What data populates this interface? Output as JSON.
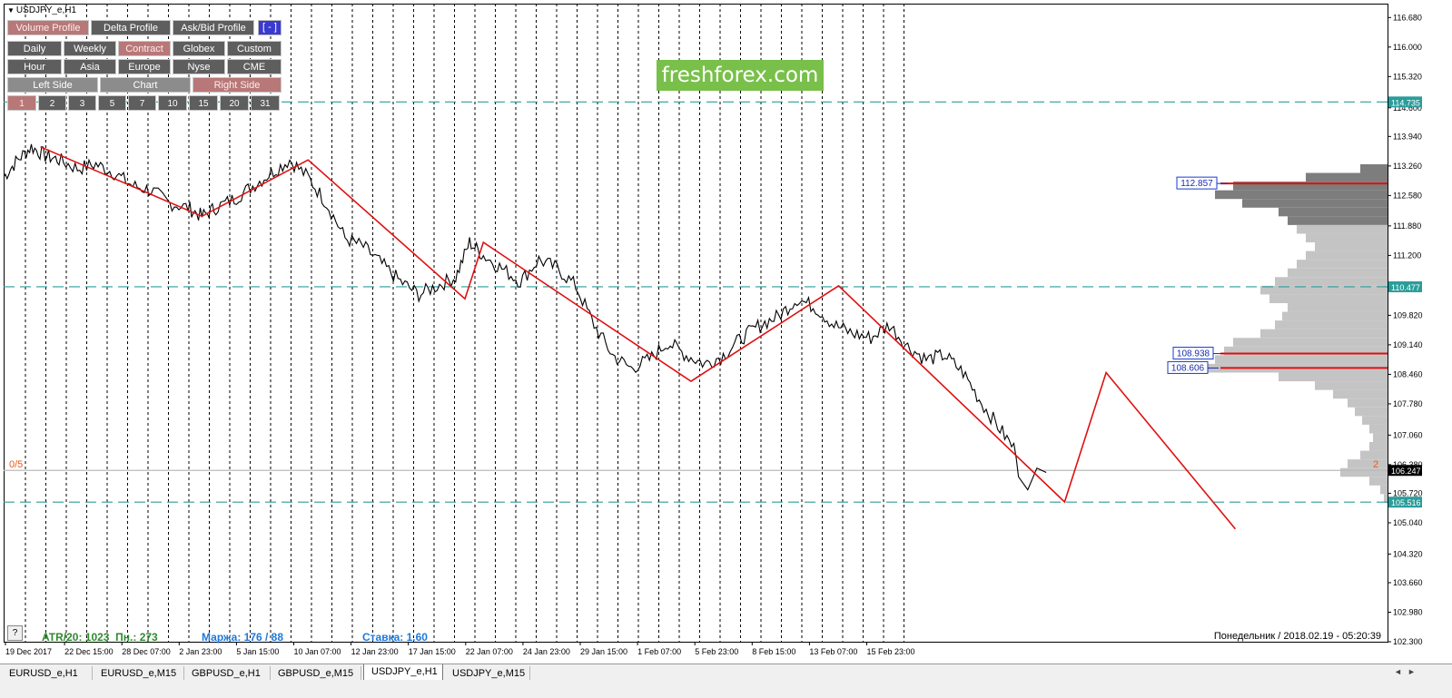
{
  "window": {
    "title": "USDJPY_e,H1"
  },
  "panel": {
    "row1": [
      {
        "label": "Volume Profile",
        "active": true
      },
      {
        "label": "Delta Profile",
        "active": false
      },
      {
        "label": "Ask/Bid Profile",
        "active": false
      }
    ],
    "collapse_label": "[ - ]",
    "row2": [
      {
        "label": "Daily",
        "active": false
      },
      {
        "label": "Weekly",
        "active": false
      },
      {
        "label": "Contract",
        "active": true
      },
      {
        "label": "Globex",
        "active": false
      },
      {
        "label": "Custom",
        "active": false
      }
    ],
    "row3": [
      {
        "label": "Hour",
        "active": false
      },
      {
        "label": "Asia",
        "active": false
      },
      {
        "label": "Europe",
        "active": false
      },
      {
        "label": "Nyse",
        "active": false
      },
      {
        "label": "CME",
        "active": false
      }
    ],
    "row4": [
      {
        "label": "Left Side",
        "active": false
      },
      {
        "label": "Chart",
        "active": false
      },
      {
        "label": "Right Side",
        "active": true
      }
    ],
    "row5": [
      {
        "label": "1",
        "active": true
      },
      {
        "label": "2",
        "active": false
      },
      {
        "label": "3",
        "active": false
      },
      {
        "label": "5",
        "active": false
      },
      {
        "label": "7",
        "active": false
      },
      {
        "label": "10",
        "active": false
      },
      {
        "label": "15",
        "active": false
      },
      {
        "label": "20",
        "active": false
      },
      {
        "label": "31",
        "active": false
      }
    ]
  },
  "logo": "freshforex.com",
  "status": {
    "atr": "ATR/20: 1023",
    "pn": "Пн.: 273",
    "margin": "Маржа: 176 / 88",
    "rate": "Ставка: 1.60",
    "datetime": "Понедельник  /  2018.02.19  -  05:20:39",
    "help": "?",
    "zero_five": "0/5",
    "right_num": "2"
  },
  "chart_data": {
    "type": "line",
    "symbol": "USDJPY_e,H1",
    "ylim": [
      102.3,
      117.0
    ],
    "price_ticks": [
      "116.680",
      "116.000",
      "115.320",
      "114.600",
      "113.940",
      "113.260",
      "112.580",
      "111.880",
      "111.200",
      "110.520",
      "109.820",
      "109.140",
      "108.460",
      "107.780",
      "107.060",
      "106.380",
      "105.720",
      "105.040",
      "104.320",
      "103.660",
      "102.980",
      "102.300"
    ],
    "time_ticks": [
      "19 Dec 2017",
      "22 Dec 15:00",
      "28 Dec 07:00",
      "2 Jan 23:00",
      "5 Jan 15:00",
      "10 Jan 07:00",
      "12 Jan 23:00",
      "17 Jan 15:00",
      "22 Jan 07:00",
      "24 Jan 23:00",
      "29 Jan 15:00",
      "1 Feb 07:00",
      "5 Feb 23:00",
      "8 Feb 15:00",
      "13 Feb 07:00",
      "15 Feb 23:00"
    ],
    "price_series": {
      "name": "USDJPY H1",
      "x": [
        0,
        3,
        6,
        9,
        12,
        16,
        20,
        24,
        28,
        32,
        36,
        40,
        43,
        46,
        50,
        54,
        58,
        62,
        66,
        70,
        74,
        78,
        82,
        86,
        90,
        94,
        98,
        101,
        104,
        108,
        112,
        116,
        120,
        124,
        128,
        132,
        136,
        140,
        144,
        148,
        152,
        156,
        160,
        164,
        168,
        172,
        176,
        180,
        184,
        188,
        192,
        196,
        200,
        204,
        208,
        212,
        216,
        220
      ],
      "y": [
        113.0,
        113.4,
        113.7,
        113.5,
        113.4,
        113.2,
        113.3,
        113.1,
        112.8,
        112.7,
        112.4,
        112.3,
        112.1,
        112.3,
        112.5,
        112.8,
        113.1,
        113.4,
        113.0,
        112.4,
        111.6,
        111.4,
        111.0,
        110.6,
        110.3,
        110.5,
        110.7,
        111.5,
        111.2,
        110.9,
        110.6,
        111.1,
        110.9,
        110.5,
        109.6,
        108.9,
        108.6,
        108.8,
        109.2,
        108.9,
        108.7,
        108.9,
        109.3,
        109.6,
        109.8,
        110.2,
        110.0,
        109.6,
        109.4,
        109.3,
        109.6,
        109.1,
        108.8,
        108.9,
        108.5,
        107.8,
        107.2,
        106.6
      ]
    },
    "tail_x": [
      220,
      222,
      224,
      226
    ],
    "tail_y": [
      106.1,
      105.8,
      106.3,
      106.2
    ],
    "zigzag": {
      "name": "zigzag",
      "x": [
        8,
        43,
        66,
        100,
        104,
        149,
        181,
        230,
        239,
        267
      ],
      "y": [
        113.7,
        112.1,
        113.4,
        110.2,
        111.5,
        108.3,
        110.5,
        105.52,
        108.5,
        104.9
      ]
    },
    "hlines": [
      {
        "price": 114.735,
        "label": "114.735",
        "style": "dashed",
        "color": "#2a9d9a"
      },
      {
        "price": 110.477,
        "label": "110.477",
        "style": "dashed",
        "color": "#2a9d9a"
      },
      {
        "price": 105.516,
        "label": "105.516",
        "style": "dashed",
        "color": "#2a9d9a"
      },
      {
        "price": 106.247,
        "label": "106.247",
        "style": "solid",
        "color": "#bbbbbb"
      }
    ],
    "profile_levels": [
      {
        "price": 112.857,
        "label": "112.857"
      },
      {
        "price": 108.938,
        "label": "108.938"
      },
      {
        "price": 108.606,
        "label": "108.606"
      }
    ],
    "volume_profile": {
      "prices": [
        113.2,
        113.0,
        112.8,
        112.6,
        112.4,
        112.2,
        112.0,
        111.8,
        111.6,
        111.4,
        111.2,
        111.0,
        110.8,
        110.6,
        110.4,
        110.2,
        110.0,
        109.8,
        109.6,
        109.4,
        109.2,
        109.0,
        108.8,
        108.6,
        108.4,
        108.2,
        108.0,
        107.8,
        107.6,
        107.4,
        107.2,
        107.0,
        106.8,
        106.6,
        106.4,
        106.2,
        106.0,
        105.8,
        105.6
      ],
      "values": [
        0.15,
        0.45,
        0.85,
        0.95,
        0.8,
        0.6,
        0.55,
        0.5,
        0.45,
        0.4,
        0.45,
        0.5,
        0.55,
        0.62,
        0.7,
        0.65,
        0.55,
        0.58,
        0.62,
        0.7,
        0.85,
        0.9,
        0.95,
        1.0,
        0.6,
        0.4,
        0.3,
        0.22,
        0.18,
        0.14,
        0.1,
        0.08,
        0.1,
        0.15,
        0.22,
        0.26,
        0.1,
        0.04,
        0.02
      ],
      "poc": 108.606
    },
    "xlim": [
      0,
      300
    ]
  },
  "tabs": {
    "items": [
      {
        "label": "EURUSD_e,H1",
        "active": false
      },
      {
        "label": "EURUSD_e,M15",
        "active": false
      },
      {
        "label": "GBPUSD_e,H1",
        "active": false
      },
      {
        "label": "GBPUSD_e,M15",
        "active": false
      },
      {
        "label": "USDJPY_e,H1",
        "active": true
      },
      {
        "label": "USDJPY_e,M15",
        "active": false
      }
    ],
    "scroll_left": "◄",
    "scroll_right": "►"
  }
}
